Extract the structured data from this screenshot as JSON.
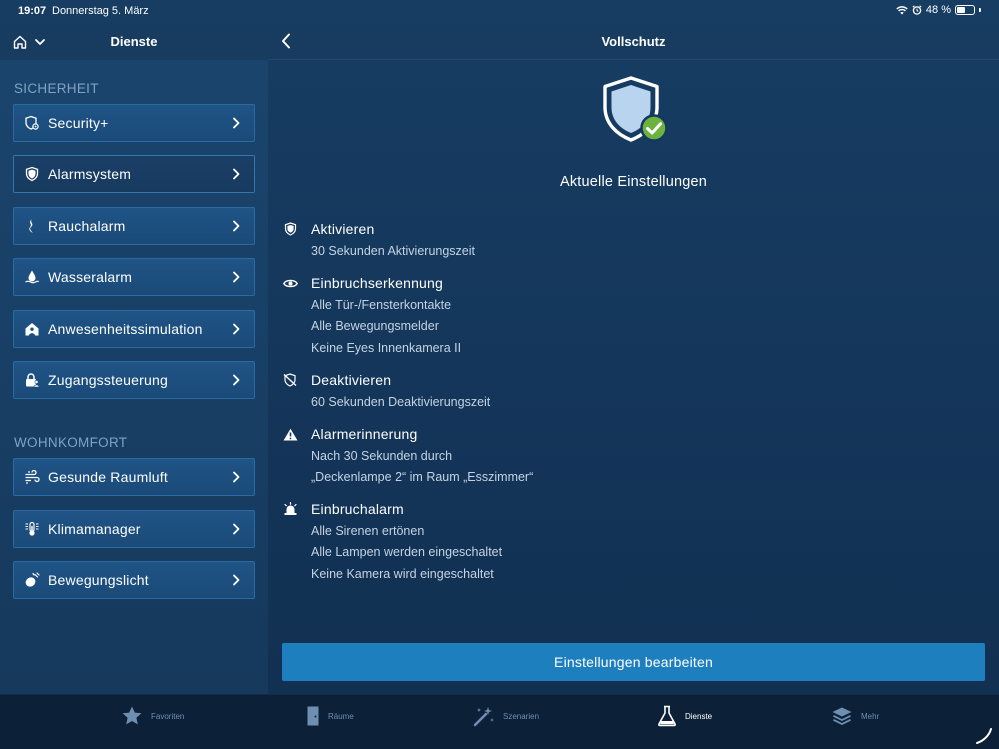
{
  "status_bar": {
    "time": "19:07",
    "date": "Donnerstag 5. März",
    "battery": "48 %",
    "battery_level": 0.48
  },
  "sidebar": {
    "title": "Dienste",
    "sections": [
      {
        "label": "SICHERHEIT",
        "items": [
          {
            "label": "Security+",
            "icon": "shield-gear-icon"
          },
          {
            "label": "Alarmsystem",
            "icon": "shield-icon",
            "active": true
          },
          {
            "label": "Rauchalarm",
            "icon": "smoke-icon"
          },
          {
            "label": "Wasseralarm",
            "icon": "water-drop-icon"
          },
          {
            "label": "Anwesenheitssimulation",
            "icon": "house-person-icon"
          },
          {
            "label": "Zugangssteuerung",
            "icon": "lock-person-icon"
          }
        ]
      },
      {
        "label": "WOHNKOMFORT",
        "items": [
          {
            "label": "Gesunde Raumluft",
            "icon": "air-flow-icon"
          },
          {
            "label": "Klimamanager",
            "icon": "thermostat-icon"
          },
          {
            "label": "Bewegungslicht",
            "icon": "motion-light-icon"
          }
        ]
      }
    ]
  },
  "main": {
    "title": "Vollschutz",
    "settings_title": "Aktuelle Einstellungen",
    "settings": [
      {
        "title": "Aktivieren",
        "icon": "shield-icon",
        "lines": [
          "30 Sekunden Aktivierungszeit"
        ]
      },
      {
        "title": "Einbruchserkennung",
        "icon": "eye-icon",
        "lines": [
          "Alle Tür-/Fensterkontakte",
          "Alle Bewegungsmelder",
          "Keine Eyes Innenkamera II"
        ]
      },
      {
        "title": "Deaktivieren",
        "icon": "shield-off-icon",
        "lines": [
          "60 Sekunden Deaktivierungszeit"
        ]
      },
      {
        "title": "Alarmerinnerung",
        "icon": "warning-icon",
        "lines": [
          "Nach 30 Sekunden durch",
          "„Deckenlampe 2“ im Raum „Esszimmer“"
        ]
      },
      {
        "title": "Einbruchalarm",
        "icon": "siren-icon",
        "lines": [
          "Alle Sirenen ertönen",
          "Alle Lampen werden eingeschaltet",
          "Keine Kamera wird eingeschaltet"
        ]
      }
    ],
    "edit_button": "Einstellungen bearbeiten"
  },
  "tabs": [
    {
      "label": "Favoriten",
      "icon": "star-icon"
    },
    {
      "label": "Räume",
      "icon": "door-icon"
    },
    {
      "label": "Szenarien",
      "icon": "magic-wand-icon"
    },
    {
      "label": "Dienste",
      "icon": "flask-icon",
      "active": true
    },
    {
      "label": "Mehr",
      "icon": "layers-icon"
    }
  ],
  "colors": {
    "accent": "#1e7fbf",
    "check": "#6cb33e",
    "muted_text": "#7fa3c6"
  }
}
